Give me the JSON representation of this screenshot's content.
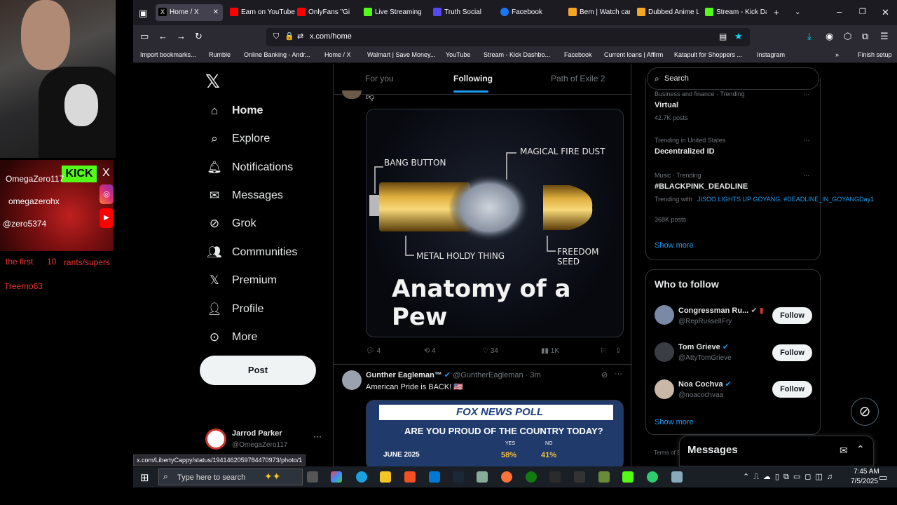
{
  "overlay": {
    "kick_badge": "KICK",
    "x_badge": "X",
    "name1": "OmegaZero117",
    "name2": "omegazerohx",
    "name3": "@zero5374",
    "rants_left": "the first",
    "rants_count": "10",
    "rants_right": "rants/supers",
    "viewer": "Treerno63"
  },
  "browser": {
    "tabs": [
      {
        "label": "Home / X",
        "color": "#000000"
      },
      {
        "label": "Earn on YouTube",
        "color": "#ff0000"
      },
      {
        "label": "OnlyFans \"Gi",
        "color": "#ff0000"
      },
      {
        "label": "Live Streaming",
        "color": "#53fc18"
      },
      {
        "label": "Truth Social",
        "color": "#5448ee"
      },
      {
        "label": "Facebook",
        "color": "#1877f2"
      },
      {
        "label": "Bem | Watch carto",
        "color": "#f5a623"
      },
      {
        "label": "Dubbed Anime Li",
        "color": "#f5a623"
      },
      {
        "label": "Stream - Kick Das",
        "color": "#53fc18"
      }
    ],
    "url": "x.com/home",
    "bookmarks": [
      "Import bookmarks...",
      "Rumble",
      "Online Banking - Andr...",
      "Home / X",
      "Walmart | Save Money...",
      "YouTube",
      "Stream - Kick Dashbo...",
      "Facebook",
      "Current loans | Affirm",
      "Katapult for Shoppers ...",
      "Instagram"
    ],
    "finish_setup": "Finish setup",
    "status_link": "x.com/LibertyCappy/status/1941462059784470973/photo/1"
  },
  "x": {
    "nav": [
      {
        "label": "Home",
        "icon": "home-icon"
      },
      {
        "label": "Explore",
        "icon": "search-icon"
      },
      {
        "label": "Notifications",
        "icon": "bell-icon"
      },
      {
        "label": "Messages",
        "icon": "mail-icon"
      },
      {
        "label": "Grok",
        "icon": "grok-icon"
      },
      {
        "label": "Communities",
        "icon": "people-icon"
      },
      {
        "label": "Premium",
        "icon": "x-icon"
      },
      {
        "label": "Profile",
        "icon": "person-icon"
      },
      {
        "label": "More",
        "icon": "more-icon"
      }
    ],
    "post_label": "Post",
    "account": {
      "name": "Jarrod Parker",
      "handle": "@OmegaZero117"
    },
    "feed_tabs": [
      "For you",
      "Following",
      "Path of Exile 2"
    ],
    "tweet1": {
      "meme": {
        "bang": "BANG BUTTON",
        "fire": "MAGICAL FIRE DUST",
        "metal": "METAL HOLDY THING",
        "freedom": "FREEDOM SEED",
        "title": "Anatomy of a Pew"
      },
      "replies": "4",
      "reposts": "4",
      "likes": "34",
      "views": "1K"
    },
    "tweet2": {
      "name": "Gunther Eagleman™",
      "handle": "@GuntherEagleman",
      "time": "· 3m",
      "text": "American Pride is BACK! 🇺🇸",
      "poll": {
        "header": "FOX NEWS POLL",
        "question": "ARE YOU PROUD OF THE COUNTRY TODAY?",
        "yes_label": "YES",
        "no_label": "NO",
        "row_label": "JUNE 2025",
        "yes": "58%",
        "no": "41%"
      }
    },
    "search_placeholder": "Search",
    "trends": [
      {
        "sub": "Business and finance · Trending",
        "title": "Virtual",
        "posts": "42.7K posts"
      },
      {
        "sub": "Trending in United States",
        "title": "Decentralized ID",
        "posts": ""
      },
      {
        "sub": "Music · Trending",
        "title": "#BLACKPINK_DEADLINE",
        "posts": "368K posts",
        "trending_with": "Trending with",
        "tags": "JISOO LIGHTS UP GOYANG, #DEADLINE_IN_GOYANGDay1"
      }
    ],
    "show_more": "Show more",
    "who_to_follow": "Who to follow",
    "follow_list": [
      {
        "name": "Congressman Ru...",
        "handle": "@RepRusselIFry"
      },
      {
        "name": "Tom Grieve",
        "handle": "@AttyTomGrieve"
      },
      {
        "name": "Noa Cochva",
        "handle": "@noacochvaa"
      }
    ],
    "follow_label": "Follow",
    "show_more_2": "Show more",
    "terms": "Terms of S",
    "messages_label": "Messages"
  },
  "taskbar": {
    "search_placeholder": "Type here to search",
    "time": "7:45 AM",
    "date": "7/5/2025"
  }
}
